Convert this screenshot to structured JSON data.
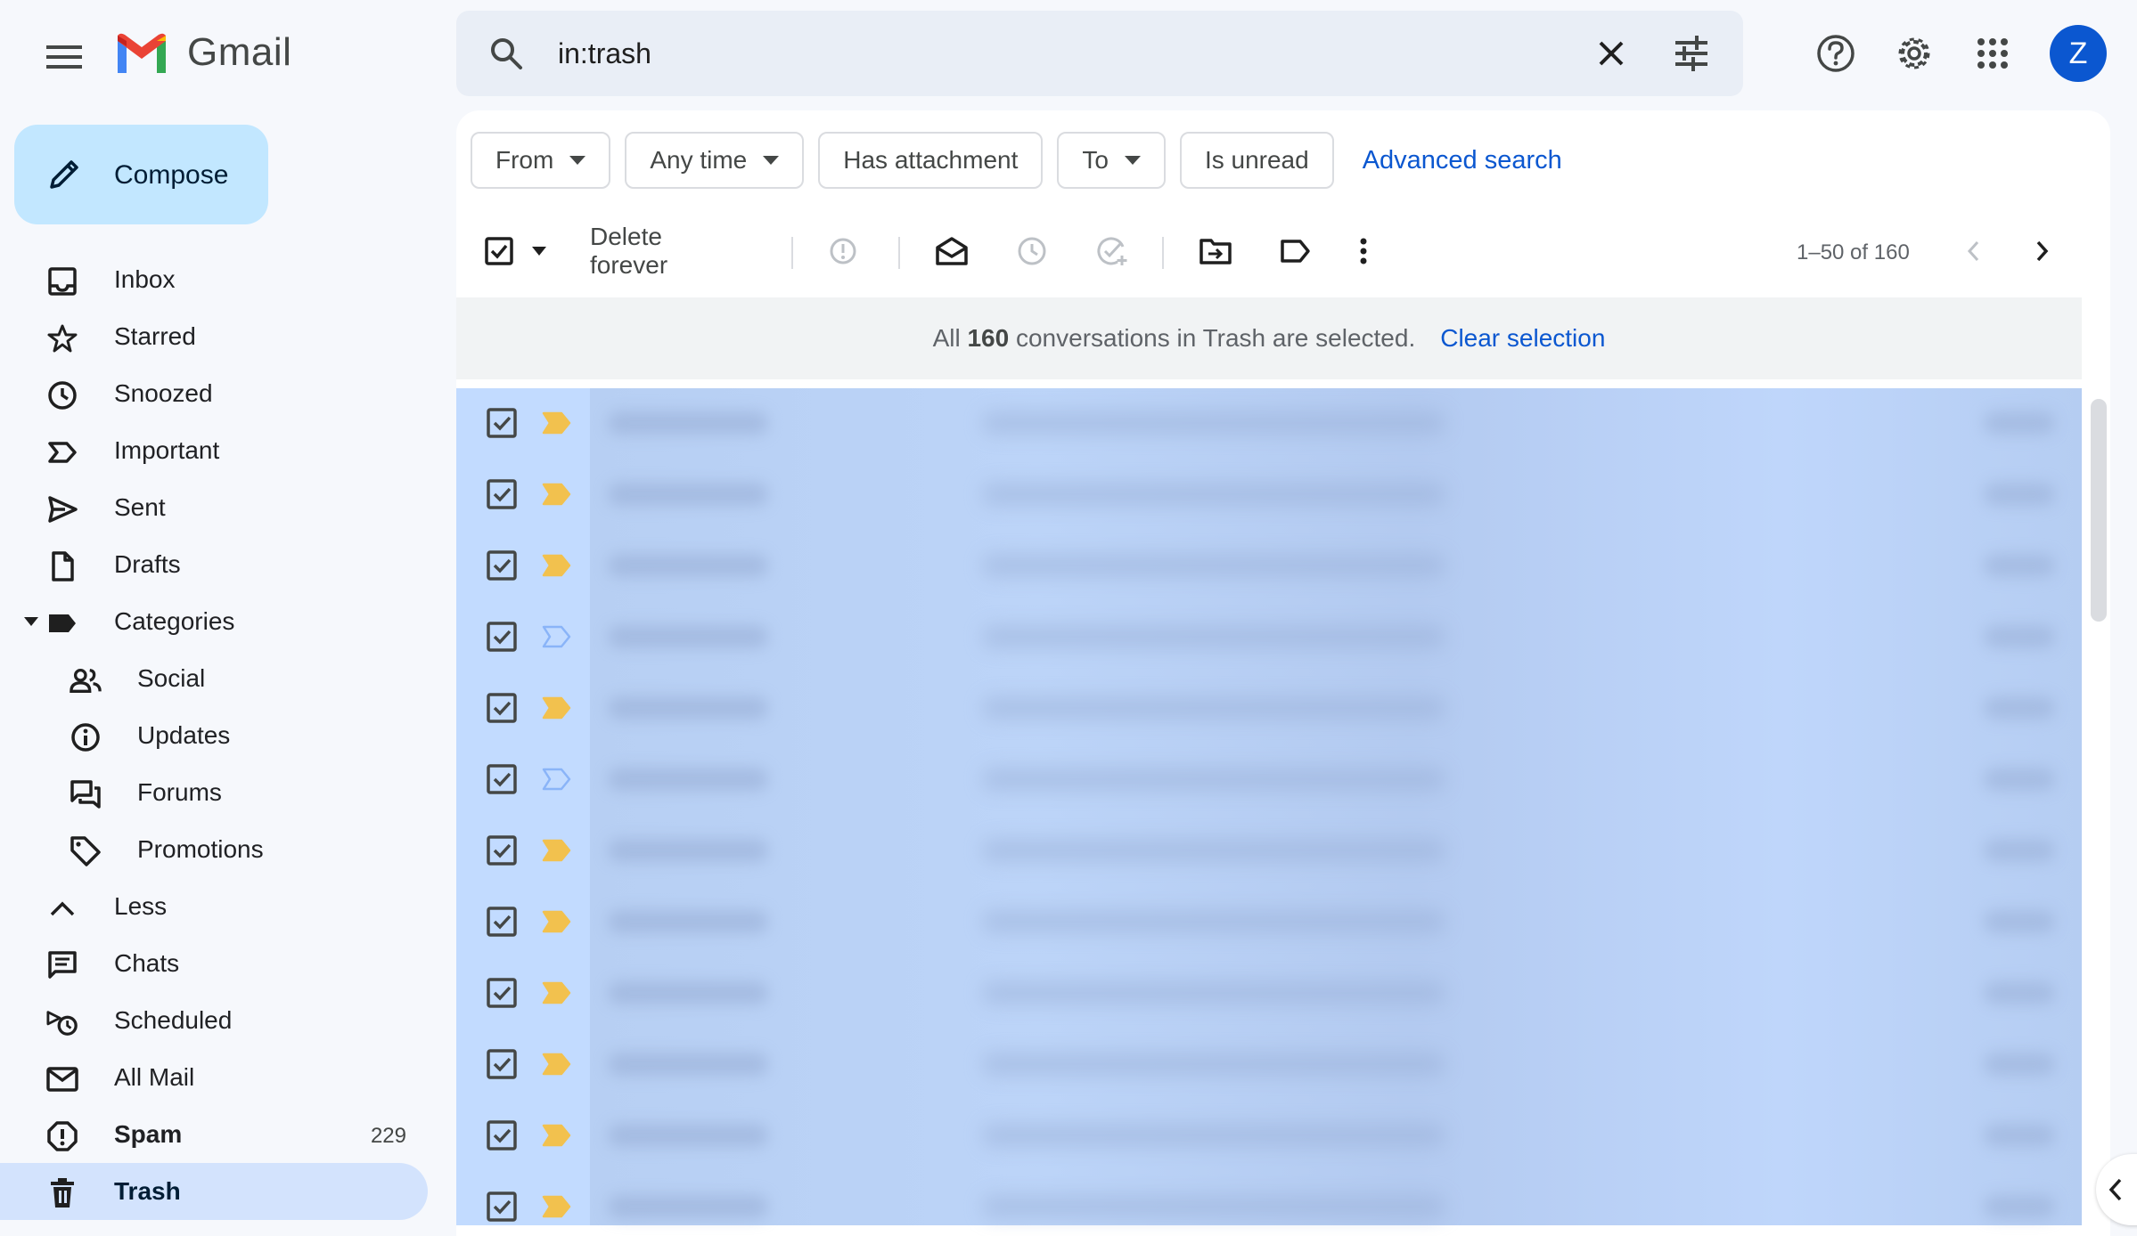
{
  "app": {
    "name": "Gmail"
  },
  "search": {
    "value": "in:trash",
    "placeholder": "Search mail"
  },
  "user": {
    "avatar_initial": "Z"
  },
  "compose": {
    "label": "Compose"
  },
  "sidebar": {
    "items": [
      {
        "label": "Inbox",
        "icon": "inbox-icon"
      },
      {
        "label": "Starred",
        "icon": "star-icon"
      },
      {
        "label": "Snoozed",
        "icon": "clock-icon"
      },
      {
        "label": "Important",
        "icon": "important-icon"
      },
      {
        "label": "Sent",
        "icon": "send-icon"
      },
      {
        "label": "Drafts",
        "icon": "draft-icon"
      },
      {
        "label": "Categories",
        "icon": "label-icon"
      },
      {
        "label": "Social",
        "icon": "people-icon"
      },
      {
        "label": "Updates",
        "icon": "info-icon"
      },
      {
        "label": "Forums",
        "icon": "forum-icon"
      },
      {
        "label": "Promotions",
        "icon": "tag-icon"
      },
      {
        "label": "Less",
        "icon": "chevron-up-icon"
      },
      {
        "label": "Chats",
        "icon": "chat-icon"
      },
      {
        "label": "Scheduled",
        "icon": "scheduled-icon"
      },
      {
        "label": "All Mail",
        "icon": "mail-icon"
      },
      {
        "label": "Spam",
        "icon": "report-icon",
        "count": "229"
      },
      {
        "label": "Trash",
        "icon": "trash-icon"
      }
    ]
  },
  "filters": {
    "from": "From",
    "any_time": "Any time",
    "has_attachment": "Has attachment",
    "to": "To",
    "is_unread": "Is unread",
    "advanced_search": "Advanced search"
  },
  "toolbar": {
    "delete_forever": "Delete forever",
    "pagination": "1–50 of 160"
  },
  "selection_banner": {
    "prefix": "All",
    "count": "160",
    "suffix": "conversations in Trash are selected.",
    "clear": "Clear selection"
  },
  "rows": [
    {
      "important": true
    },
    {
      "important": true
    },
    {
      "important": true
    },
    {
      "important": false
    },
    {
      "important": true
    },
    {
      "important": false
    },
    {
      "important": true
    },
    {
      "important": true
    },
    {
      "important": true
    },
    {
      "important": true
    },
    {
      "important": true
    },
    {
      "important": true
    }
  ],
  "colors": {
    "accent": "#0b57d0",
    "selected_row": "#c2dbff",
    "important_marker": "#f2c14e",
    "active_nav": "#d3e3fd",
    "compose_bg": "#c2e7ff"
  }
}
